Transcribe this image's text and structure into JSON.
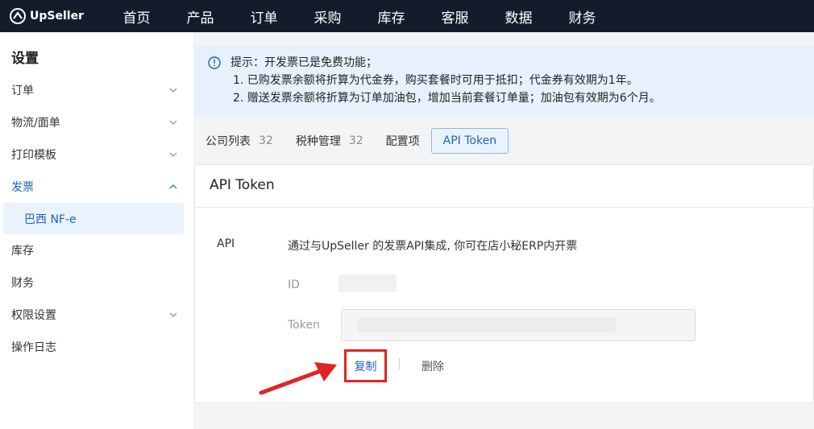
{
  "app": {
    "logo_text": "UpSeller"
  },
  "nav": [
    "首页",
    "产品",
    "订单",
    "采购",
    "库存",
    "客服",
    "数据",
    "财务"
  ],
  "sidebar": {
    "title": "设置",
    "items": [
      {
        "label": "订单",
        "chevron": "down"
      },
      {
        "label": "物流/面单",
        "chevron": "down"
      },
      {
        "label": "打印模板",
        "chevron": "down"
      },
      {
        "label": "发票",
        "chevron": "up",
        "active": true
      },
      {
        "label": "库存"
      },
      {
        "label": "财务"
      },
      {
        "label": "权限设置",
        "chevron": "down"
      },
      {
        "label": "操作日志"
      }
    ],
    "subitem": "巴西 NF-e"
  },
  "notice": {
    "line1": "提示：开发票已是免费功能；",
    "line2": "1. 已购发票余额将折算为代金券，购买套餐时可用于抵扣；代金券有效期为1年。",
    "line3": "2. 赠送发票余额将折算为订单加油包，增加当前套餐订单量；加油包有效期为6个月。"
  },
  "tabs": [
    {
      "label": "公司列表",
      "count": "32"
    },
    {
      "label": "税种管理",
      "count": "32"
    },
    {
      "label": "配置项"
    },
    {
      "label": "API Token",
      "active": true
    }
  ],
  "card": {
    "title": "API Token",
    "api_label": "API",
    "api_desc": "通过与UpSeller 的发票API集成, 你可在店小秘ERP内开票",
    "id_label": "ID",
    "token_label": "Token",
    "copy_label": "复制",
    "separator": "|",
    "delete_label": "删除"
  },
  "colors": {
    "accent": "#1d63c6",
    "topbar": "#141c2c",
    "highlight": "#e02424"
  }
}
